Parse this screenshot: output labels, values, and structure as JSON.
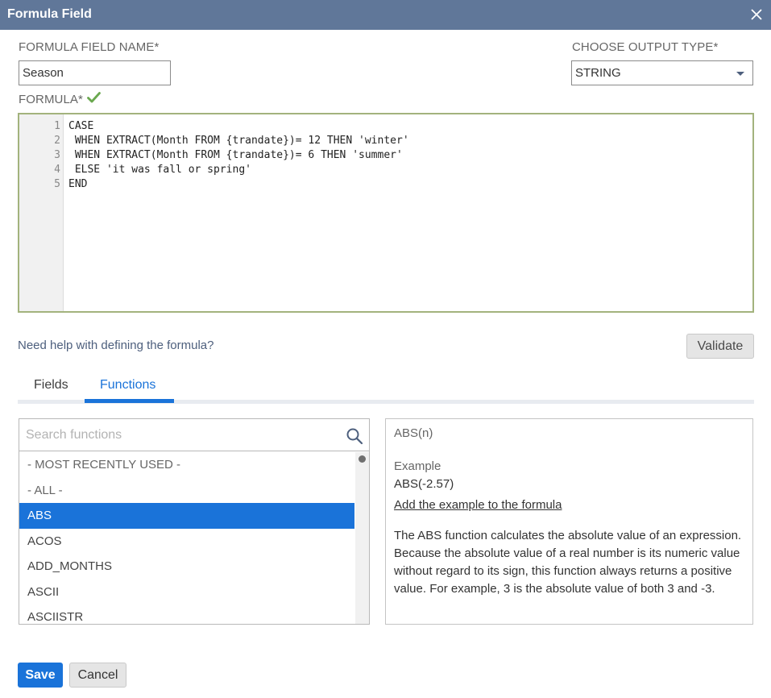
{
  "dialog": {
    "title": "Formula Field"
  },
  "form": {
    "name_label": "FORMULA FIELD NAME*",
    "name_value": "Season",
    "output_label": "CHOOSE OUTPUT TYPE*",
    "output_value": "STRING",
    "formula_label": "FORMULA*"
  },
  "editor": {
    "lines": [
      {
        "num": "1",
        "code": "CASE"
      },
      {
        "num": "2",
        "code": " WHEN EXTRACT(Month FROM {trandate})= 12 THEN 'winter'"
      },
      {
        "num": "3",
        "code": " WHEN EXTRACT(Month FROM {trandate})= 6 THEN 'summer'"
      },
      {
        "num": "4",
        "code": " ELSE 'it was fall or spring'"
      },
      {
        "num": "5",
        "code": "END"
      }
    ]
  },
  "help_link": "Need help with defining the formula?",
  "validate_label": "Validate",
  "tabs": [
    {
      "label": "Fields",
      "active": false
    },
    {
      "label": "Functions",
      "active": true
    }
  ],
  "functions": {
    "search_placeholder": "Search functions",
    "items": [
      {
        "label": "- MOST RECENTLY USED -",
        "selected": false
      },
      {
        "label": "- ALL -",
        "selected": false
      },
      {
        "label": "ABS",
        "selected": true
      },
      {
        "label": "ACOS",
        "selected": false
      },
      {
        "label": "ADD_MONTHS",
        "selected": false
      },
      {
        "label": "ASCII",
        "selected": false
      },
      {
        "label": "ASCIISTR",
        "selected": false
      }
    ]
  },
  "detail": {
    "signature": "ABS(n)",
    "example_label": "Example",
    "example_value": "ABS(-2.57)",
    "add_example_link": "Add the example to the formula",
    "description": "The ABS function calculates the absolute value of an expression. Because the absolute value of a real number is its numeric value without regard to its sign, this function always returns a positive value. For example, 3 is the absolute value of both 3 and -3."
  },
  "footer": {
    "save_label": "Save",
    "cancel_label": "Cancel"
  },
  "colors": {
    "titlebar": "#607799",
    "accent": "#1a73d9",
    "valid_check": "#6aa84f",
    "editor_border": "#a3b37d"
  },
  "icons": {
    "close": "close-icon",
    "valid": "checkmark-icon",
    "dropdown": "chevron-down-icon",
    "search": "search-icon"
  }
}
